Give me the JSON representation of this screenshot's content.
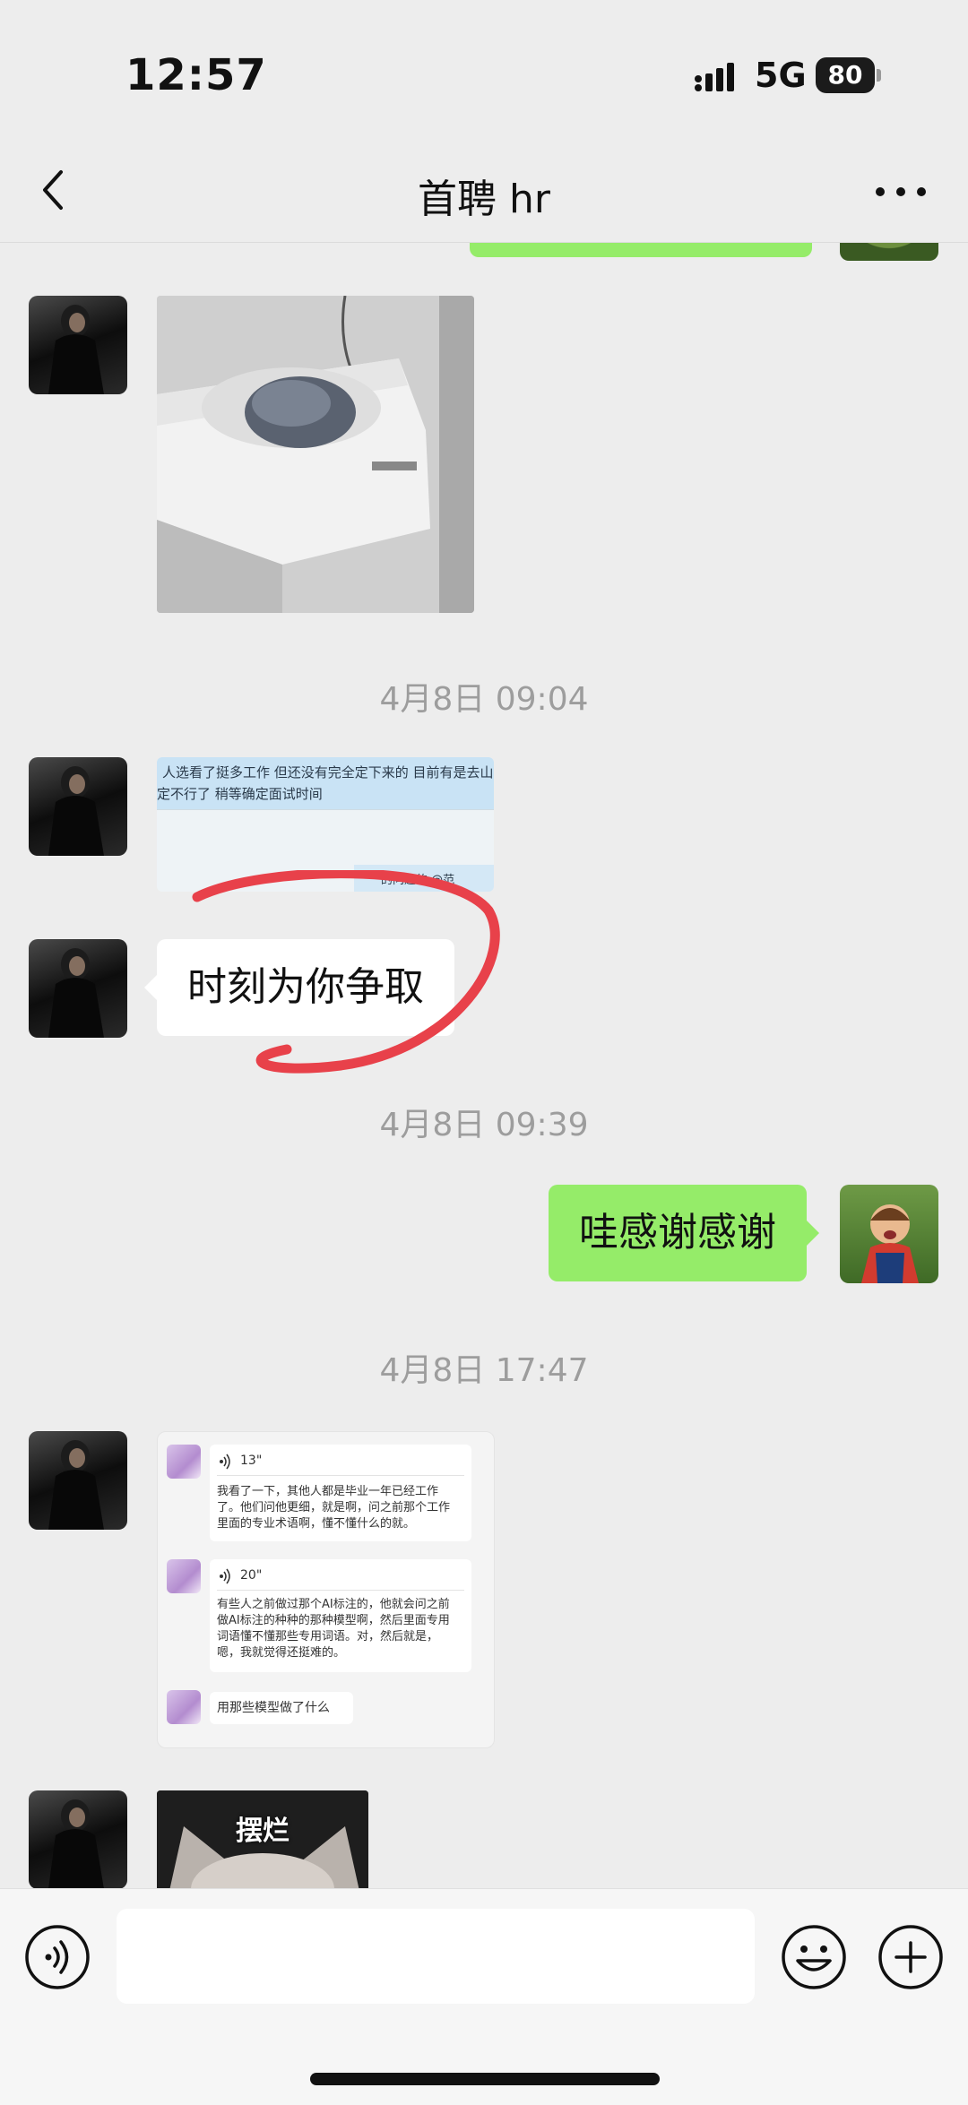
{
  "status_bar": {
    "time": "12:57",
    "network": "5G",
    "battery": "80"
  },
  "nav": {
    "title": "首聘 hr",
    "back_icon": "chevron-left-icon",
    "more_icon": "more-dots-icon"
  },
  "messages": {
    "time1": "4月8日 09:04",
    "shot_line1": "人选看了挺多工作  但还没有完全定下来的   目前有是去山东了",
    "shot_line2": "定不行了  稍等确定面试时间",
    "shot_line3": "的问题的 @范",
    "bubble_left": "时刻为你争取",
    "time2": "4月8日 09:39",
    "bubble_right": "哇感谢感谢",
    "time3": "4月8日 17:47",
    "voice1_duration": "13\"",
    "voice1_text": "我看了一下，其他人都是毕业一年已经工作\n了。他们问他更细，就是啊，问之前那个工作\n里面的专业术语啊，懂不懂什么的就。",
    "voice2_duration": "20\"",
    "voice2_text": "有些人之前做过那个AI标注的，他就会问之前\n做AI标注的种种的那种模型啊，然后里面专用\n词语懂不懂那些专用词语。对，然后就是，\n嗯，我就觉得还挺难的。",
    "voice3_text": "用那些模型做了什么",
    "sticker_caption": "摆烂"
  },
  "input_bar": {
    "voice_icon": "voice-icon",
    "emoji_icon": "emoji-icon",
    "plus_icon": "plus-icon",
    "input_value": ""
  },
  "colors": {
    "background": "#ededed",
    "bubble_green": "#95ec69",
    "annotation_red": "#e8414a"
  }
}
